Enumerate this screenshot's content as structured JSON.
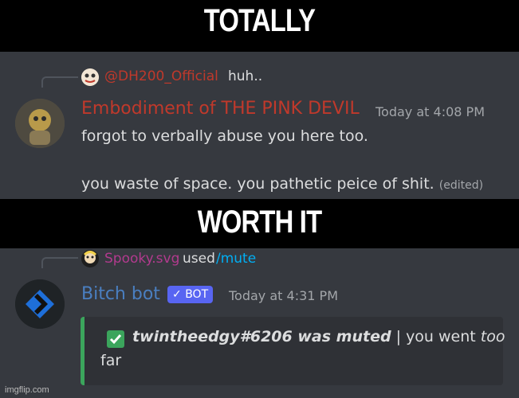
{
  "captions": {
    "top": "TOTALLY",
    "middle": "WORTH IT"
  },
  "message1": {
    "reply": {
      "username": "@DH200_Official",
      "text": "huh.."
    },
    "author": "Embodiment of THE PINK DEVIL",
    "timestamp": "Today at 4:08 PM",
    "line1": "forgot to verbally abuse you here too.",
    "line2": "you waste of space. you pathetic peice of shit.",
    "edited": "(edited)"
  },
  "message2": {
    "reply": {
      "username": "Spooky.svg",
      "used": "used",
      "command": "/mute"
    },
    "author": "Bitch bot",
    "badge": "BOT",
    "timestamp": "Today at 4:31 PM",
    "embed": {
      "bold_text": "twintheedgy#6206 was muted",
      "separator": "|",
      "text_a": "you went",
      "text_b": "too",
      "text_c": "far"
    }
  },
  "watermark": "imgflip.com",
  "colors": {
    "background": "#36393f",
    "reply_user_1": "#c0392b",
    "author_1": "#c0392b",
    "reply_user_2": "#b23a8e",
    "author_2": "#4a7fc1",
    "bot_badge": "#5865f2",
    "embed_accent": "#3ba55c",
    "command": "#00aff4"
  }
}
